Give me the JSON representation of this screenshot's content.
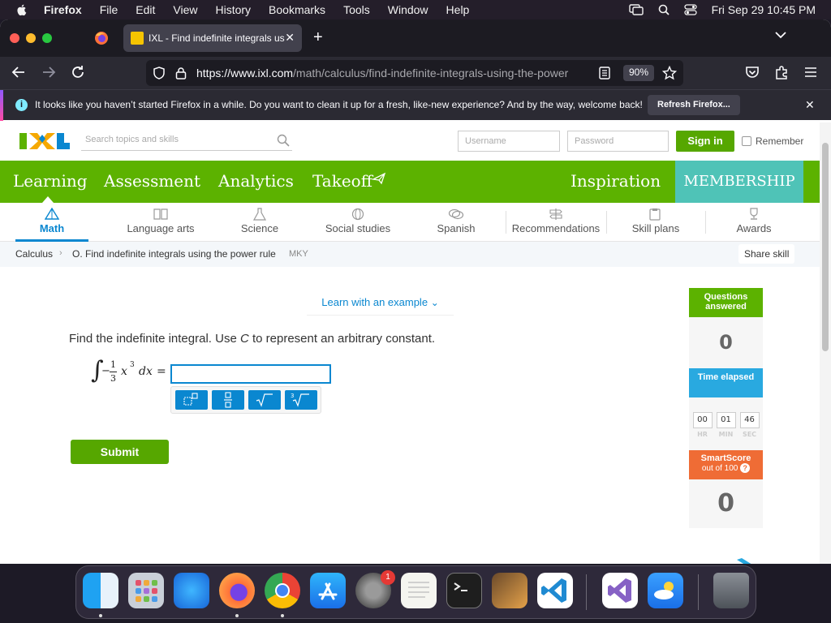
{
  "menubar": {
    "app_name": "Firefox",
    "items": [
      "File",
      "Edit",
      "View",
      "History",
      "Bookmarks",
      "Tools",
      "Window",
      "Help"
    ],
    "clock": "Fri Sep 29  10:45 PM"
  },
  "browser": {
    "tab_title": "IXL - Find indefinite integrals us",
    "url_host": "https://www.ixl.com",
    "url_path": "/math/calculus/find-indefinite-integrals-using-the-power",
    "zoom": "90%",
    "notification": {
      "message": "It looks like you haven’t started Firefox in a while. Do you want to clean it up for a fresh, like-new experience? And by the way, welcome back!",
      "button": "Refresh Firefox..."
    }
  },
  "ixl": {
    "search_placeholder": "Search topics and skills",
    "username_placeholder": "Username",
    "password_placeholder": "Password",
    "signin": "Sign in",
    "remember": "Remember",
    "nav": {
      "learning": "Learning",
      "assessment": "Assessment",
      "analytics": "Analytics",
      "takeoff": "Takeoff",
      "inspiration": "Inspiration",
      "membership": "MEMBERSHIP"
    },
    "subnav": [
      "Math",
      "Language arts",
      "Science",
      "Social studies",
      "Spanish",
      "Recommendations",
      "Skill plans",
      "Awards"
    ],
    "breadcrumb": {
      "subject": "Calculus",
      "skill": "O. Find indefinite integrals using the power rule",
      "code": "MKY",
      "share": "Share skill"
    },
    "learn_example": "Learn with an example",
    "question": "Find the indefinite integral. Use C to represent an arbitrary constant.",
    "question_pre": "Find the indefinite integral. Use ",
    "question_var": "C",
    "question_post": " to represent an arbitrary constant.",
    "integral": {
      "sign": "−",
      "numerator": "1",
      "denominator": "3",
      "variable": "x",
      "exponent": "3",
      "differential": "dx",
      "equals": "="
    },
    "submit": "Submit",
    "sidebar": {
      "questions_label": "Questions answered",
      "questions_value": "0",
      "time_label": "Time elapsed",
      "hr": "00",
      "min": "01",
      "sec": "46",
      "hr_label": "HR",
      "min_label": "MIN",
      "sec_label": "SEC",
      "smartscore_label": "SmartScore",
      "smartscore_sub": "out of 100",
      "smartscore_value": "0"
    }
  },
  "dock": {
    "settings_badge": "1"
  },
  "colors": {
    "ixl_green": "#5cb200",
    "ixl_blue": "#0a87d0",
    "membership_teal": "#4fc3b7",
    "smartscore_orange": "#ef6c35"
  }
}
